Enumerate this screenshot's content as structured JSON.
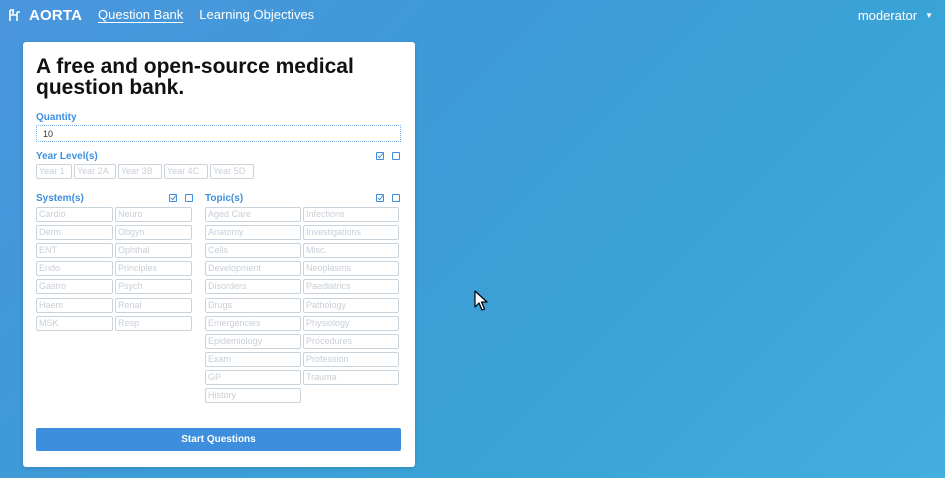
{
  "brand": {
    "name": "AORTA"
  },
  "nav": {
    "items": [
      {
        "label": "Question Bank",
        "active": true
      },
      {
        "label": "Learning Objectives",
        "active": false
      }
    ]
  },
  "user": {
    "name": "moderator"
  },
  "card": {
    "title": "A free and open-source medical question bank.",
    "quantity_label": "Quantity",
    "quantity_value": "10",
    "year_label": "Year Level(s)",
    "years": [
      "Year 1",
      "Year 2A",
      "Year 3B",
      "Year 4C",
      "Year 5D"
    ],
    "system_label": "System(s)",
    "systems": [
      "Cardio",
      "Neuro",
      "Derm",
      "Obgyn",
      "ENT",
      "Ophthal",
      "Endo",
      "Principles",
      "Gastro",
      "Psych",
      "Haem",
      "Renal",
      "MSK",
      "Resp"
    ],
    "topic_label": "Topic(s)",
    "topics": [
      "Aged Care",
      "Infections",
      "Anatomy",
      "Investigations",
      "Cells",
      "Misc.",
      "Development",
      "Neoplasms",
      "Disorders",
      "Paediatrics",
      "Drugs",
      "Pathology",
      "Emergencies",
      "Physiology",
      "Epidemiology",
      "Procedures",
      "Exam",
      "Profession",
      "GP",
      "Trauma",
      "History"
    ],
    "start_label": "Start Questions"
  },
  "colors": {
    "accent": "#3d8fdd",
    "background": "#4a9ddd"
  }
}
